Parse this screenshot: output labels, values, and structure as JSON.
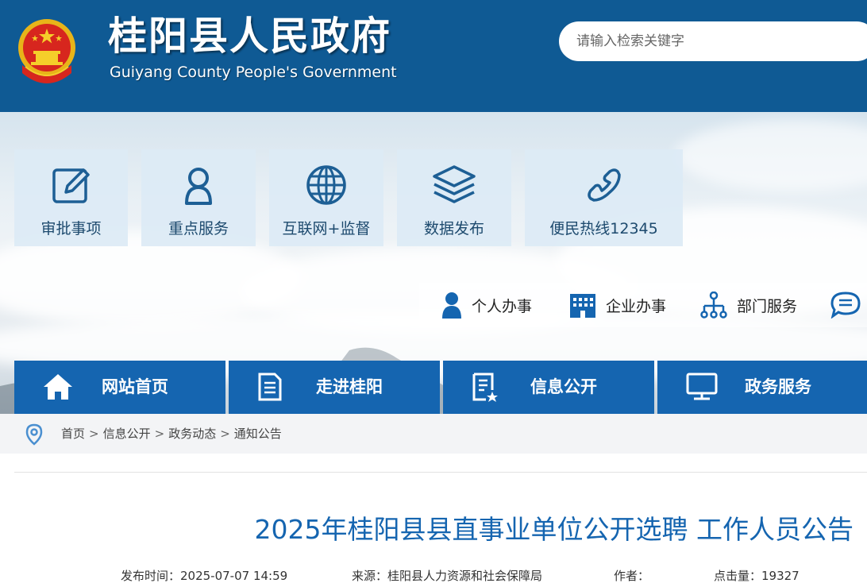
{
  "header": {
    "title": "桂阳县人民政府",
    "subtitle": "Guiyang County People's Government",
    "search_placeholder": "请输入检索关键字"
  },
  "service_tiles": [
    {
      "label": "审批事项",
      "icon": "edit-icon"
    },
    {
      "label": "重点服务",
      "icon": "user-icon"
    },
    {
      "label": "互联网+监督",
      "icon": "globe-icon"
    },
    {
      "label": "数据发布",
      "icon": "layers-icon"
    },
    {
      "label": "便民热线12345",
      "icon": "phone-icon"
    }
  ],
  "quick_links": [
    {
      "label": "个人办事",
      "icon": "person-icon"
    },
    {
      "label": "企业办事",
      "icon": "building-icon"
    },
    {
      "label": "部门服务",
      "icon": "org-chart-icon"
    },
    {
      "label": "",
      "icon": "chat-icon"
    }
  ],
  "nav": [
    {
      "label": "网站首页",
      "icon": "home-icon"
    },
    {
      "label": "走进桂阳",
      "icon": "document-icon"
    },
    {
      "label": "信息公开",
      "icon": "info-doc-icon"
    },
    {
      "label": "政务服务",
      "icon": "monitor-icon"
    }
  ],
  "breadcrumb": {
    "items": [
      "首页",
      "信息公开",
      "政务动态",
      "通知公告"
    ],
    "separator": ">"
  },
  "article": {
    "title": "2025年桂阳县县直事业单位公开选聘 工作人员公告",
    "published": "发布时间：2025-07-07 14:59",
    "source": "来源：桂阳县人力资源和社会保障局",
    "author": "作者：",
    "views": "点击量：19327"
  },
  "colors": {
    "header_bg": "#0f5a94",
    "nav_bg": "#1565b0",
    "title_color": "#1565b0",
    "tile_bg": "#dceaf5"
  }
}
